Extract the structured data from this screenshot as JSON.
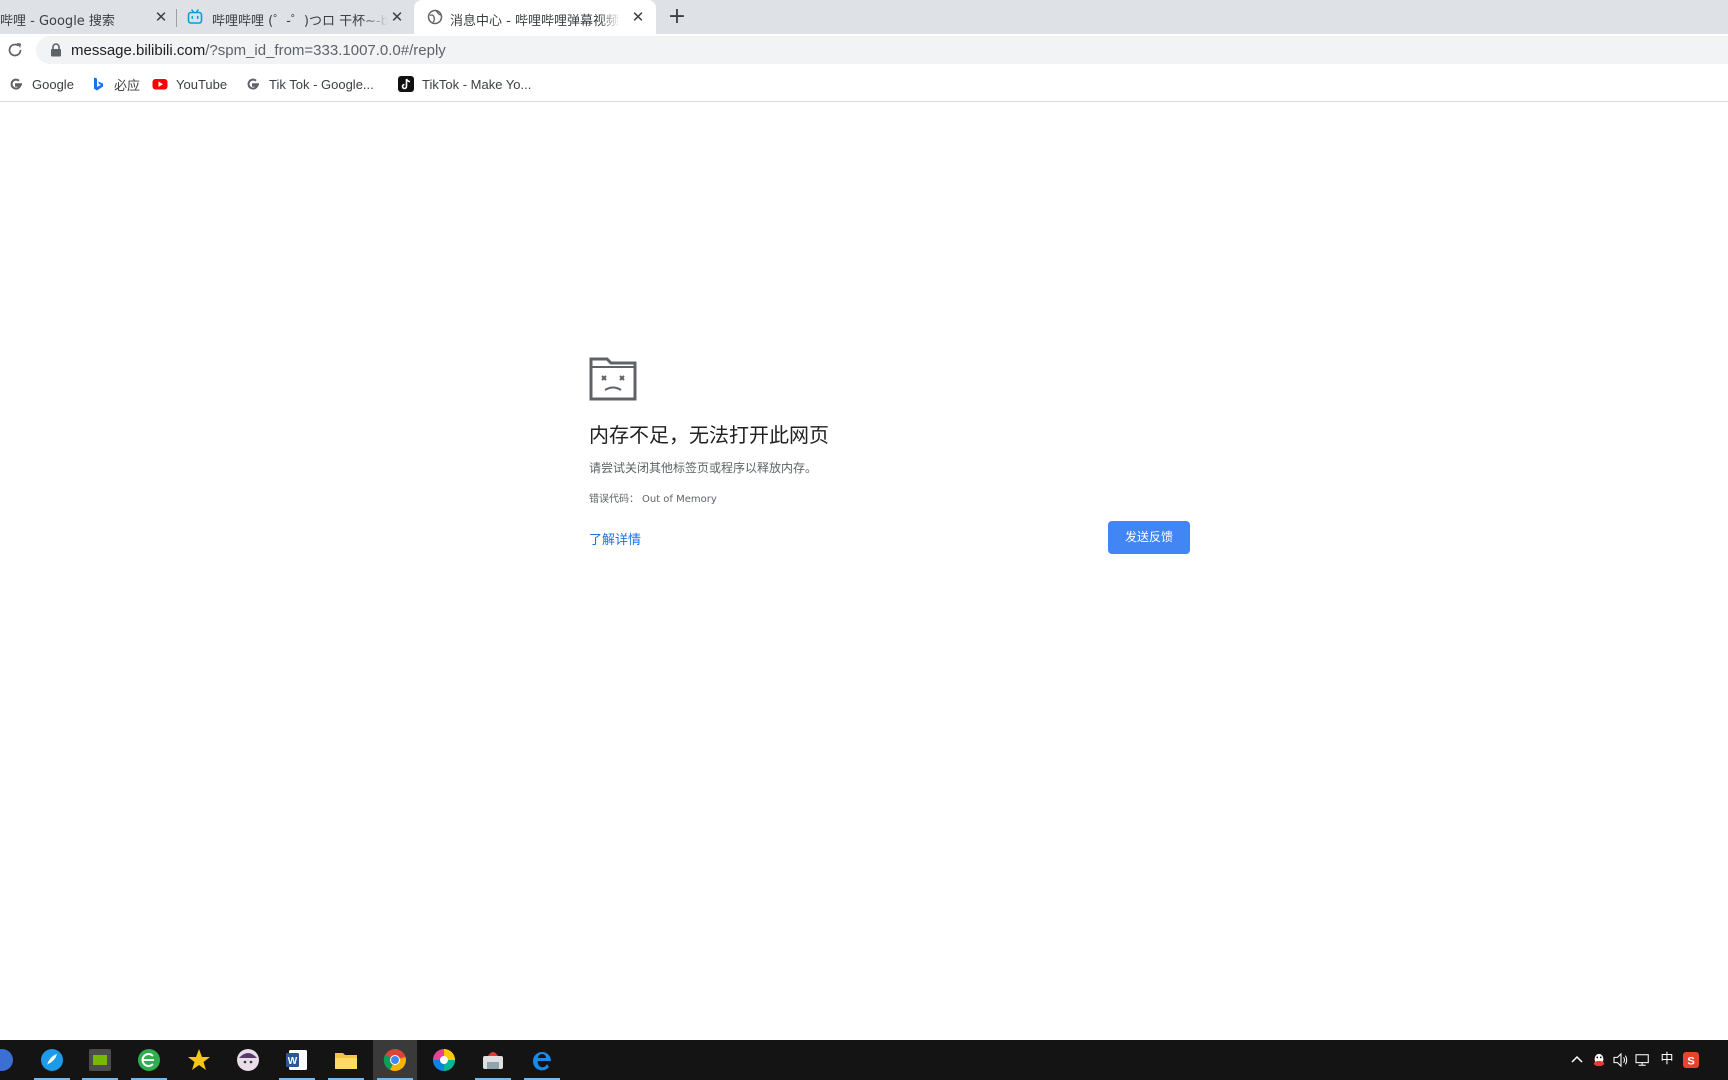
{
  "tabs": [
    {
      "title": "哔哩 - Google 搜索",
      "icon": "google-icon"
    },
    {
      "title": "哔哩哔哩 (゜-゜)つロ 干杯~-bilibili",
      "icon": "bilibili-icon"
    },
    {
      "title": "消息中心 - 哔哩哔哩弹幕视频网",
      "icon": "globe-icon",
      "active": true
    }
  ],
  "toolbar": {
    "url_host": "message.bilibili.com",
    "url_rest": "/?spm_id_from=333.1007.0.0#/reply"
  },
  "bookmarks": [
    {
      "label": "Google",
      "icon": "google-icon"
    },
    {
      "label": "必应",
      "icon": "bing-icon"
    },
    {
      "label": "YouTube",
      "icon": "youtube-icon"
    },
    {
      "label": "Tik Tok - Google...",
      "icon": "google-icon"
    },
    {
      "label": "TikTok - Make Yo...",
      "icon": "tiktok-icon"
    }
  ],
  "error": {
    "heading": "内存不足，无法打开此网页",
    "subtext": "请尝试关闭其他标签页或程序以释放内存。",
    "code_label": "错误代码：",
    "code": "Out of Memory",
    "learn_more": "了解详情",
    "feedback_button": "发送反馈"
  },
  "tray": {
    "ime": "中"
  },
  "colors": {
    "tabstrip": "#dee1e6",
    "link": "#1a73e8",
    "button": "#4285f4",
    "taskbar": "#141414"
  }
}
